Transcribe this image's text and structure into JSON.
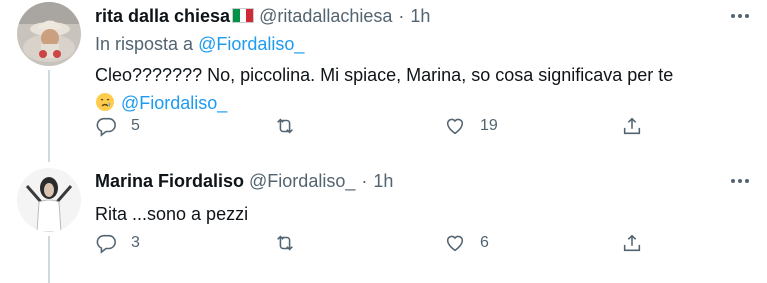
{
  "tweets": [
    {
      "name": "rita dalla chiesa",
      "handle": "@ritadallachiesa",
      "dot": "·",
      "time": "1h",
      "reply_prefix": "In risposta a",
      "reply_handle": "@Fiordaliso_",
      "text_line1": "Cleo??????? No, piccolina. Mi spiace, Marina, so cosa significava per te",
      "text_mention": "@Fiordaliso_",
      "emoji": "crying-face",
      "replies": "5",
      "retweets": "",
      "likes": "19",
      "flag_colors": [
        "#009246",
        "#ffffff",
        "#ce2b37"
      ]
    },
    {
      "name": "Marina Fiordaliso",
      "handle": "@Fiordaliso_",
      "dot": "·",
      "time": "1h",
      "text_line1": "Rita ...sono a pezzi",
      "replies": "3",
      "retweets": "",
      "likes": "6"
    }
  ],
  "colors": {
    "accent": "#1d9bf0",
    "secondary_text": "#536471",
    "primary_text": "#0f1419",
    "thread_line": "#cfd9de"
  }
}
